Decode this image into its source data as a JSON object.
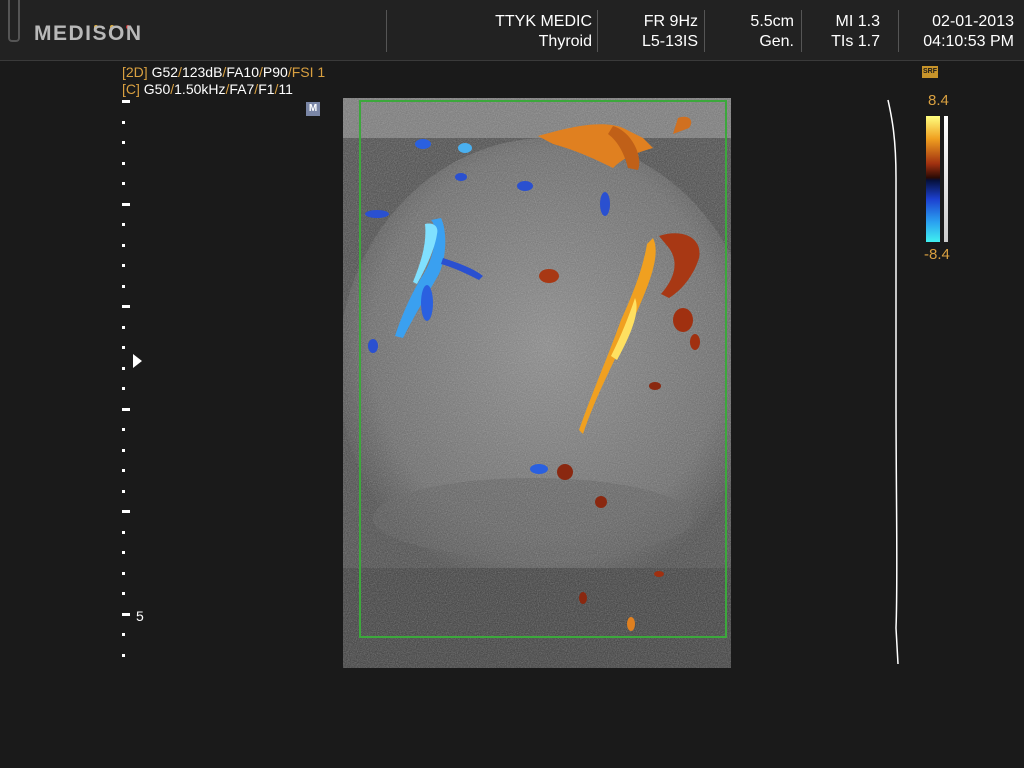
{
  "brand": {
    "name": "MEDISON",
    "dot_colors": [
      "#e0b040",
      "#e0b040",
      "#d03030"
    ]
  },
  "header": {
    "site": "TTYK MEDIC",
    "preset": "Thyroid",
    "frame_rate": "FR 9Hz",
    "probe": "L5-13IS",
    "depth": "5.5cm",
    "mode": "Gen.",
    "mi": "MI 1.3",
    "tis": "TIs 1.7",
    "date": "02-01-2013",
    "time": "04:10:53 PM"
  },
  "params": {
    "mode_2d": "[2D]",
    "gain_2d": "G52",
    "dynamic_range": "123dB",
    "fa_2d": "FA10",
    "power": "P90",
    "fsi": "FSI 1",
    "mode_c": "[C]",
    "gain_c": "G50",
    "prf": "1.50kHz",
    "fa_c": "FA7",
    "filter": "F1",
    "persistence": "11",
    "marker": "M"
  },
  "depth_scale": {
    "label_5cm": "5"
  },
  "color_scale": {
    "max": "8.4",
    "min": "-8.4",
    "badge": "SRF",
    "roi_color": "#3ca83c",
    "positive_color": "#f0a020",
    "negative_color": "#2aa0f0"
  }
}
